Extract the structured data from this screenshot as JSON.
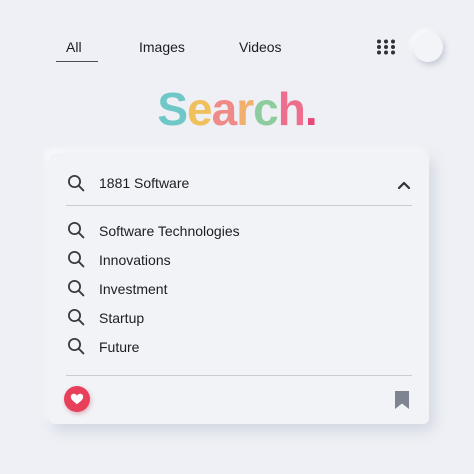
{
  "nav": {
    "tabs": [
      {
        "label": "All",
        "active": true
      },
      {
        "label": "Images",
        "active": false
      },
      {
        "label": "Videos",
        "active": false
      }
    ],
    "apps_icon": "apps-grid-icon",
    "profile_icon": "profile-button"
  },
  "logo": {
    "letters": [
      "S",
      "e",
      "a",
      "r",
      "c",
      "h",
      "."
    ],
    "colors": [
      "#70c7c8",
      "#f0c05d",
      "#f08a86",
      "#f1b06e",
      "#8ccc9d",
      "#ee6f8d",
      "#e9487a"
    ]
  },
  "search": {
    "value": "1881 Software",
    "placeholder": "",
    "icon": "search-icon",
    "toggle_icon": "chevron-up-icon"
  },
  "suggestions": [
    {
      "label": "Software Technologies"
    },
    {
      "label": "Innovations"
    },
    {
      "label": "Investment"
    },
    {
      "label": "Startup"
    },
    {
      "label": "Future"
    }
  ],
  "footer": {
    "favorite_icon": "heart-icon",
    "bookmark_icon": "bookmark-icon",
    "accent_color": "#e8405a"
  }
}
